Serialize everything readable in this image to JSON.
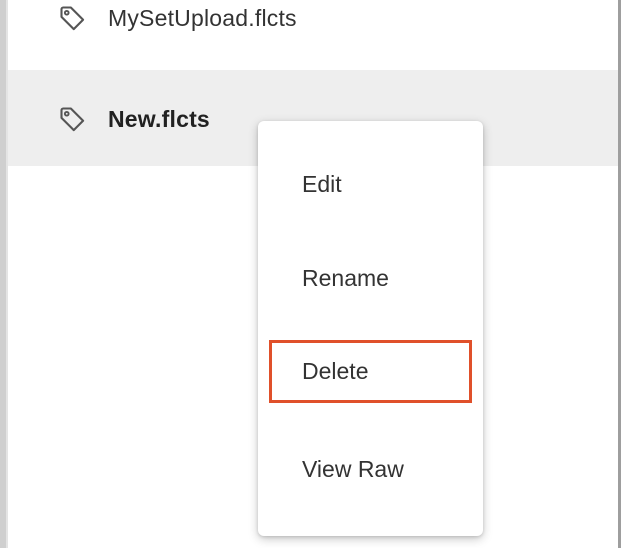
{
  "list": {
    "items": [
      {
        "label": "MySetUpload.flcts",
        "icon": "tag-icon"
      },
      {
        "label": "New.flcts",
        "icon": "tag-icon"
      }
    ]
  },
  "context_menu": {
    "items": [
      {
        "label": "Edit"
      },
      {
        "label": "Rename"
      },
      {
        "label": "Delete"
      },
      {
        "label": "View Raw"
      }
    ]
  },
  "colors": {
    "highlight_border": "#e0502a",
    "selected_row_bg": "#eeeeee"
  }
}
